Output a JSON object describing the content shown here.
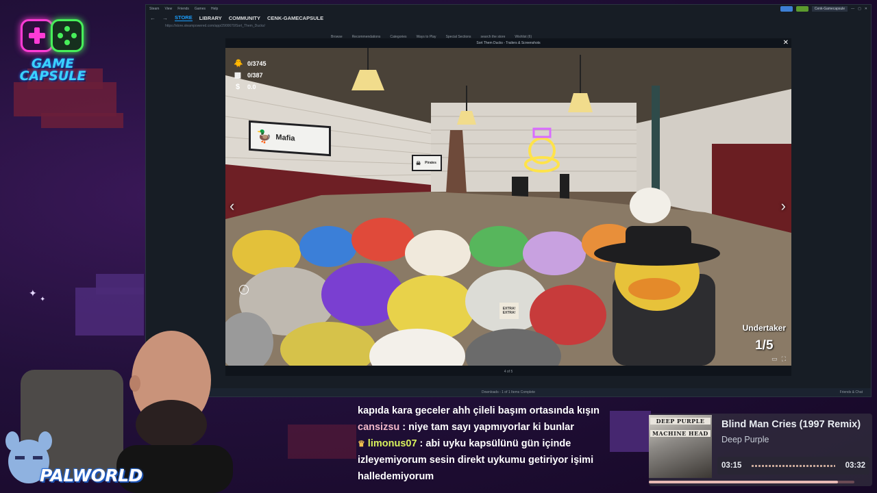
{
  "overlay": {
    "logo_line1": "GAME",
    "logo_line2": "CAPSULE",
    "palworld": "PALWORLD"
  },
  "steam": {
    "titlebar_items": [
      "Steam",
      "View",
      "Friends",
      "Games",
      "Help"
    ],
    "account": "Cenk-Gamecapsule",
    "nav": [
      "STORE",
      "LIBRARY",
      "COMMUNITY",
      "CENK-GAMECAPSULE"
    ],
    "active_nav": "STORE",
    "url": "https://store.steampowered.com/app/2900670/Sort_Them_Ducks/",
    "store_menu": [
      "Browse",
      "Recommendations",
      "Categories",
      "Ways to Play",
      "Special Sections",
      "search the store",
      "Wishlist (6)"
    ],
    "status_center": "Downloads - 1 of 1 Items Complete",
    "status_right": "Friends & Chat"
  },
  "viewer": {
    "title": "Sort Them Ducks - Trailers & Screenshots",
    "counter": "4 of 5",
    "close_icon": "close-icon",
    "prev_icon": "chevron-left-icon",
    "next_icon": "chevron-right-icon"
  },
  "game_hud": {
    "ducks": "0/3745",
    "crates": "0/387",
    "money": "0.0",
    "sign_mafia": "Mafia",
    "sign_pirates": "Pirates",
    "rank_name": "Undertaker",
    "rank_progress": "1/5",
    "hand_label": "EXTRA! EXTRA!"
  },
  "chat": {
    "lines": [
      {
        "user": "",
        "text": "kapıda kara geceler ahh çileli başım ortasında kışın"
      },
      {
        "user": "cansizsu",
        "user_color": "#f2b8c8",
        "text": ": niye tam sayı yapmıyorlar ki bunlar"
      },
      {
        "user": "limonus07",
        "user_color": "#d9f25c",
        "badge": "crown-icon",
        "text": ": abi uyku kapsülünü gün içinde"
      },
      {
        "user": "",
        "text": "izleyemiyorum sesin direkt uykumu getiriyor işimi"
      },
      {
        "user": "",
        "text": "halledemiyorum"
      }
    ]
  },
  "now_playing": {
    "title": "Blind Man Cries (1997 Remix)",
    "artist": "Deep Purple",
    "album_text_1": "DEEP PURPLE",
    "album_text_2": "MACHINE HEAD",
    "elapsed": "03:15",
    "total": "03:32",
    "progress": 0.92
  }
}
